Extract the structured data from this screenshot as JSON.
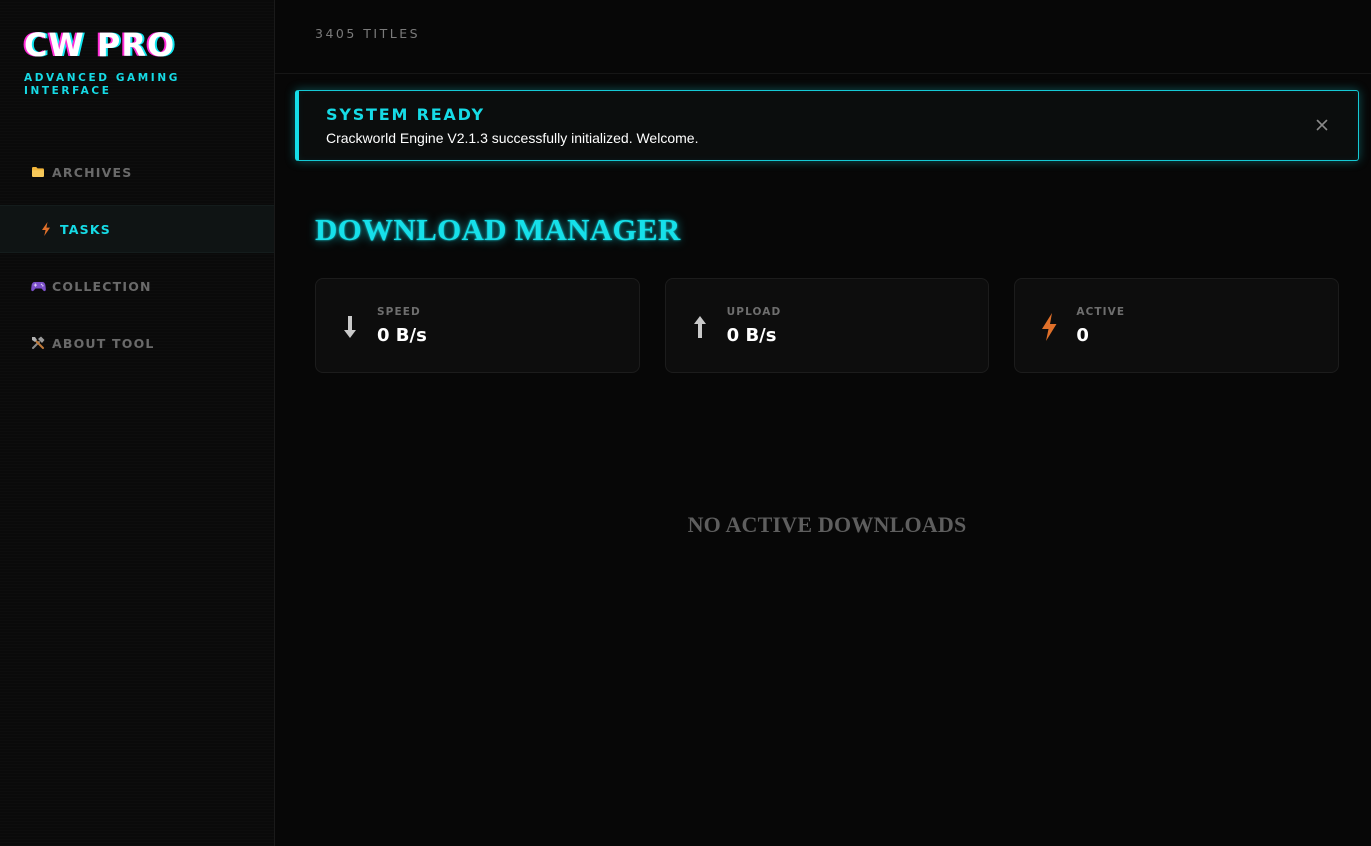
{
  "brand": {
    "title": "CW PRO",
    "subtitle": "ADVANCED GAMING INTERFACE"
  },
  "sidebar": {
    "items": [
      {
        "label": "ARCHIVES",
        "icon": "folder-icon",
        "active": false
      },
      {
        "label": "TASKS",
        "icon": "lightning-icon",
        "active": true
      },
      {
        "label": "COLLECTION",
        "icon": "gamepad-icon",
        "active": false
      },
      {
        "label": "ABOUT TOOL",
        "icon": "tools-icon",
        "active": false
      }
    ]
  },
  "header": {
    "titles_count": "3405 TITLES"
  },
  "toast": {
    "title": "SYSTEM READY",
    "message": "Crackworld Engine V2.1.3 successfully initialized. Welcome.",
    "close_icon": "close-icon"
  },
  "main": {
    "title": "DOWNLOAD MANAGER",
    "empty_text": "NO ACTIVE DOWNLOADS"
  },
  "stats": [
    {
      "label": "SPEED",
      "value": "0 B/s",
      "icon": "arrow-down-icon"
    },
    {
      "label": "UPLOAD",
      "value": "0 B/s",
      "icon": "arrow-up-icon"
    },
    {
      "label": "ACTIVE",
      "value": "0",
      "icon": "lightning-icon"
    }
  ],
  "colors": {
    "accent": "#16dbe6",
    "background": "#070707",
    "lightning": "#e0702a",
    "folder": "#f2b53a"
  }
}
